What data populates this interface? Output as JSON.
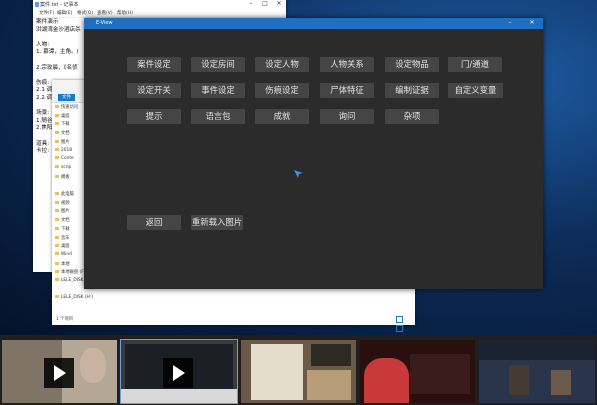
{
  "notepad": {
    "title": "案件.txt - 记事本",
    "menus": [
      "文件(F)",
      "编辑(E)",
      "格式(O)",
      "查看(V)",
      "帮助(H)"
    ],
    "lines": [
      "案件演示",
      "洪湖湾金沙酒店杀",
      "",
      "人物:",
      "1. 慕谭，主角。(",
      "",
      "2.宗玫晨，《名侦",
      "",
      "伤痕:",
      "2.1 调",
      "2.2 调",
      "",
      "场景:",
      "1.随谷",
      "2.焦阳",
      "",
      "道具:",
      "卡拉:"
    ]
  },
  "explorer": {
    "file_tab": "文件",
    "nav_items": [
      "快速访问",
      "桌面",
      "下载",
      "文档",
      "图片",
      "2018",
      "Conte",
      "scrip",
      "模板",
      "",
      "此电脑",
      "视频",
      "图片",
      "文档",
      "下载",
      "音乐",
      "桌面",
      "Wind",
      "本地",
      "本地磁盘 (F:)",
      "LELE_DISK (H:)",
      "",
      "LELE_DISK (H:)"
    ],
    "status": "1 个项目"
  },
  "app": {
    "title": "E-View",
    "buttons_row1": [
      "案件设定",
      "设定房间",
      "设定人物",
      "人物关系",
      "设定物品",
      "门/通道"
    ],
    "buttons_row2": [
      "设定开关",
      "事件设定",
      "伤痕设定",
      "尸体特征",
      "编制证据",
      "自定义变量"
    ],
    "buttons_row3": [
      "提示",
      "语言包",
      "成就",
      "询问",
      "杂项"
    ],
    "back_label": "返回",
    "reload_label": "重新载入图片"
  },
  "taskbar": {
    "thumb_labels": [
      "",
      "",
      "",
      "",
      ""
    ]
  }
}
